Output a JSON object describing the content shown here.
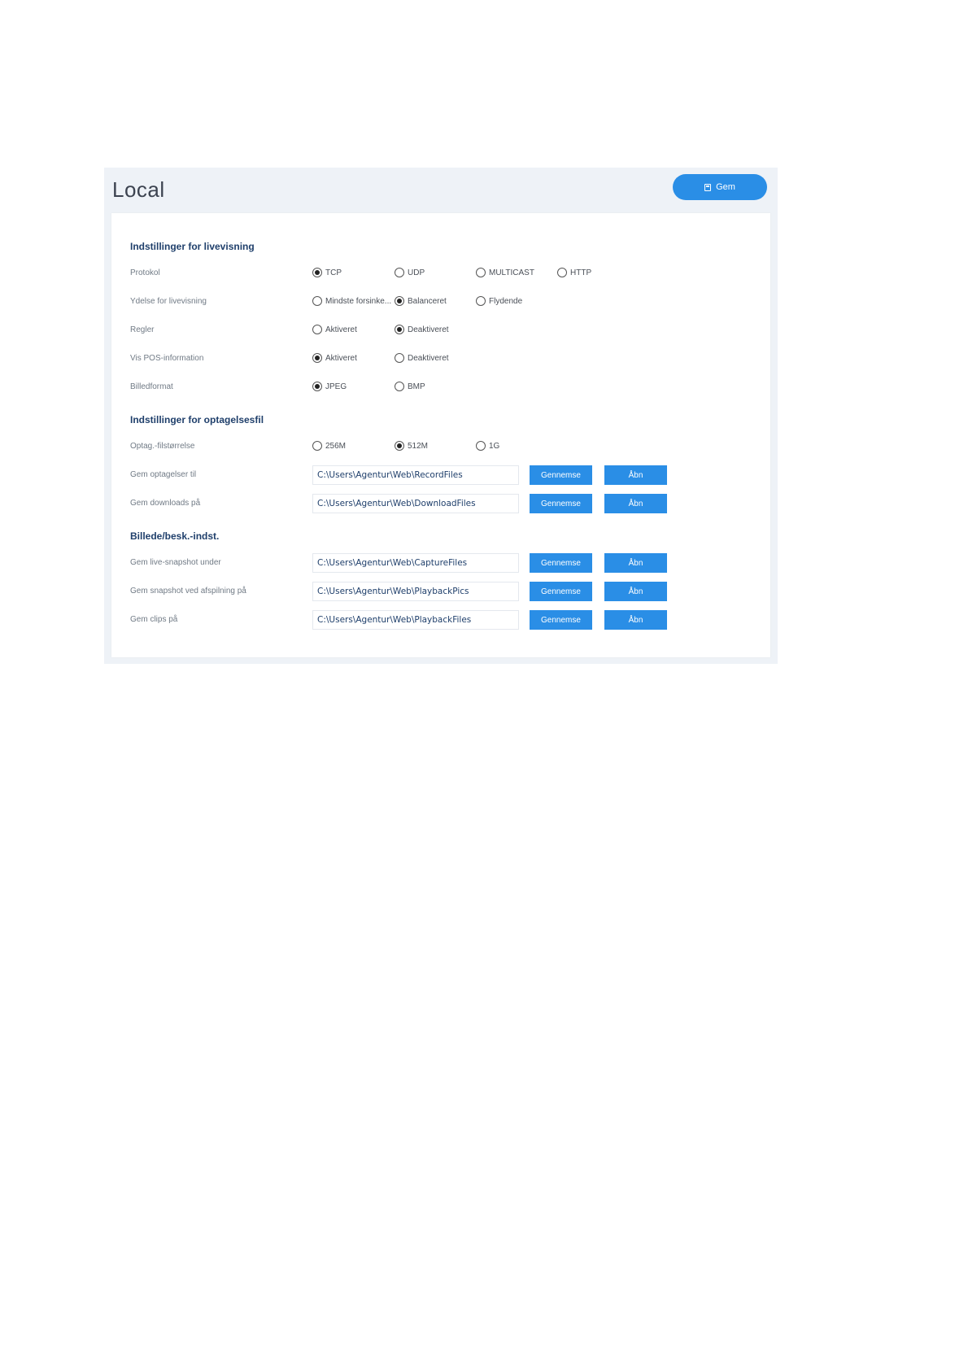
{
  "page": {
    "title": "Local",
    "save_label": "Gem",
    "save_icon": "save-icon"
  },
  "sections": {
    "live": "Indstillinger for livevisning",
    "record": "Indstillinger for optagelsesfil",
    "snapshot": "Billede/besk.-indst."
  },
  "rows": {
    "protocol": {
      "label": "Protokol",
      "options": [
        "TCP",
        "UDP",
        "MULTICAST",
        "HTTP"
      ],
      "selected": "TCP"
    },
    "performance": {
      "label": "Ydelse for livevisning",
      "options": [
        "Mindste forsinke...",
        "Balanceret",
        "Flydende"
      ],
      "selected": "Balanceret"
    },
    "rules": {
      "label": "Regler",
      "options": [
        "Aktiveret",
        "Deaktiveret"
      ],
      "selected": "Deaktiveret"
    },
    "pos": {
      "label": "Vis POS-information",
      "options": [
        "Aktiveret",
        "Deaktiveret"
      ],
      "selected": "Aktiveret"
    },
    "image_format": {
      "label": "Billedformat",
      "options": [
        "JPEG",
        "BMP"
      ],
      "selected": "JPEG"
    },
    "file_size": {
      "label": "Optag.-filstørrelse",
      "options": [
        "256M",
        "512M",
        "1G"
      ],
      "selected": "512M"
    }
  },
  "paths": [
    {
      "label": "Gem optagelser til",
      "value": "C:\\Users\\Agentur\\Web\\RecordFiles"
    },
    {
      "label": "Gem downloads på",
      "value": "C:\\Users\\Agentur\\Web\\DownloadFiles"
    },
    {
      "label": "Gem live-snapshot under",
      "value": "C:\\Users\\Agentur\\Web\\CaptureFiles"
    },
    {
      "label": "Gem snapshot ved afspilning på",
      "value": "C:\\Users\\Agentur\\Web\\PlaybackPics"
    },
    {
      "label": "Gem clips på",
      "value": "C:\\Users\\Agentur\\Web\\PlaybackFiles"
    }
  ],
  "buttons": {
    "browse": "Gennemse",
    "open": "Åbn"
  },
  "colors": {
    "accent": "#2a8ee6",
    "section_title": "#1f3f6b",
    "panel_bg": "#eef2f7"
  }
}
